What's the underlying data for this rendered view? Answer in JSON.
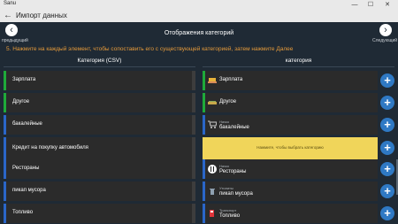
{
  "window": {
    "app_name": "Sanu",
    "minimize": "—",
    "maximize": "☐",
    "close": "✕"
  },
  "header": {
    "back": "←",
    "title": "Импорт данных"
  },
  "nav": {
    "prev_label": "предыдущий",
    "next_label": "Следующий",
    "prev_glyph": "‹",
    "next_glyph": "›"
  },
  "page": {
    "title": "Отображения категорий",
    "instruction": "5. Нажмите на каждый элемент, чтобы сопоставить его с существующей категорией, затем нажмите Далее"
  },
  "columns": {
    "left": "Категория (CSV)",
    "right": "категория"
  },
  "csv_categories": [
    {
      "label": "Зарплата",
      "color": "#1faa3a"
    },
    {
      "label": "Другое",
      "color": "#1faa3a"
    },
    {
      "label": "бакалейные",
      "color": "#2a66c9"
    },
    {
      "label": "Кредит на покупку автомобиля",
      "color": "#2a66c9"
    },
    {
      "label": "Рестораны",
      "color": "#2a66c9"
    },
    {
      "label": "пикап мусора",
      "color": "#2a66c9"
    },
    {
      "label": "Топливо",
      "color": "#2a66c9"
    }
  ],
  "mapped": [
    {
      "parent": "",
      "name": "Зарплата",
      "color": "#1faa3a",
      "icon": "money-hand-icon"
    },
    {
      "parent": "",
      "name": "Другое",
      "color": "#1faa3a",
      "icon": "money-icon"
    },
    {
      "parent": "Начко",
      "name": "бакалейные",
      "color": "#2a66c9",
      "icon": "shopping-cart-icon"
    },
    {
      "parent": "Начко",
      "name": "Рестораны",
      "color": "#2a66c9",
      "icon": "fork-knife-icon"
    },
    {
      "parent": "Утилиты",
      "name": "пикап мусора",
      "color": "#2a66c9",
      "icon": "trash-icon"
    },
    {
      "parent": "Транспорт",
      "name": "Топливо",
      "color": "#2a66c9",
      "icon": "fuel-pump-icon"
    }
  ],
  "unmapped_prompt": "Нажмите, чтобы выбрать категорию",
  "plus_glyph": "+"
}
